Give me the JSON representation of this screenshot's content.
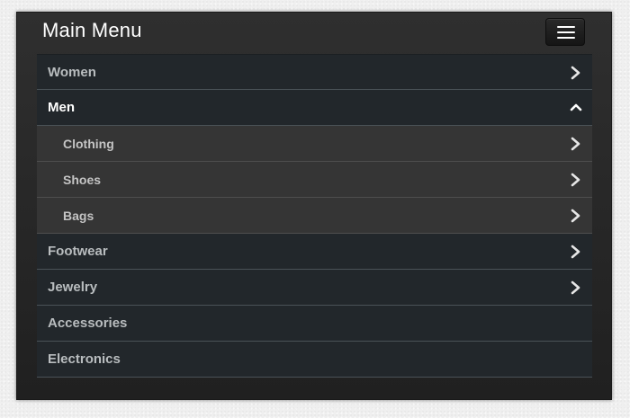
{
  "header": {
    "title": "Main Menu",
    "toggle_icon": "hamburger-menu-icon"
  },
  "menu": {
    "items": [
      {
        "label": "Women",
        "icon": "chevron-right-icon"
      },
      {
        "label": "Men",
        "icon": "chevron-up-icon",
        "expanded": true,
        "children": [
          {
            "label": "Clothing",
            "icon": "chevron-right-icon"
          },
          {
            "label": "Shoes",
            "icon": "chevron-right-icon"
          },
          {
            "label": "Bags",
            "icon": "chevron-right-icon"
          }
        ]
      },
      {
        "label": "Footwear",
        "icon": "chevron-right-icon"
      },
      {
        "label": "Jewelry",
        "icon": "chevron-right-icon"
      },
      {
        "label": "Accessories"
      },
      {
        "label": "Electronics"
      }
    ]
  },
  "colors": {
    "panel_bg": "#2a2a2a",
    "item_bg": "#22272b",
    "subitem_bg": "#353535",
    "divider": "#4a5257",
    "label": "#b9bdbf",
    "active_label": "#ffffff",
    "page_bg": "#efefef"
  }
}
